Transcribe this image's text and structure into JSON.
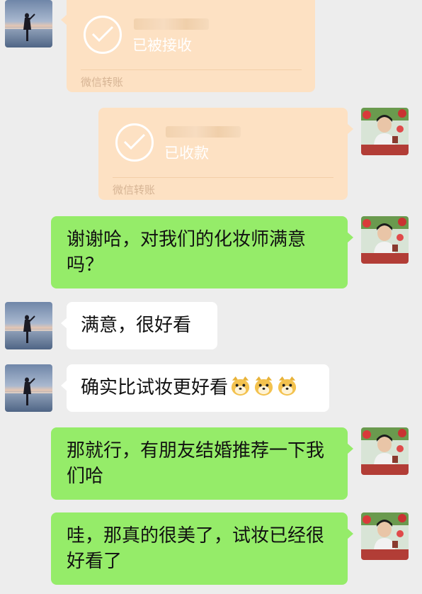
{
  "transfers": [
    {
      "status": "已被接收",
      "footer": "微信转账"
    },
    {
      "status": "已收款",
      "footer": "微信转账"
    }
  ],
  "messages": [
    {
      "text": "谢谢哈，对我们的化妆师满意吗？"
    },
    {
      "text": "满意，很好看"
    },
    {
      "text": "确实比试妆更好看"
    },
    {
      "text": "那就行，有朋友结婚推荐一下我们哈"
    },
    {
      "text": "哇，那真的很美了，试妆已经很好看了"
    }
  ],
  "emoji": [
    "doge-emoji",
    "doge-emoji",
    "doge-emoji"
  ],
  "colors": {
    "green_bubble": "#95ec69",
    "transfer_bubble": "#fde1c3",
    "background": "#ededed"
  }
}
